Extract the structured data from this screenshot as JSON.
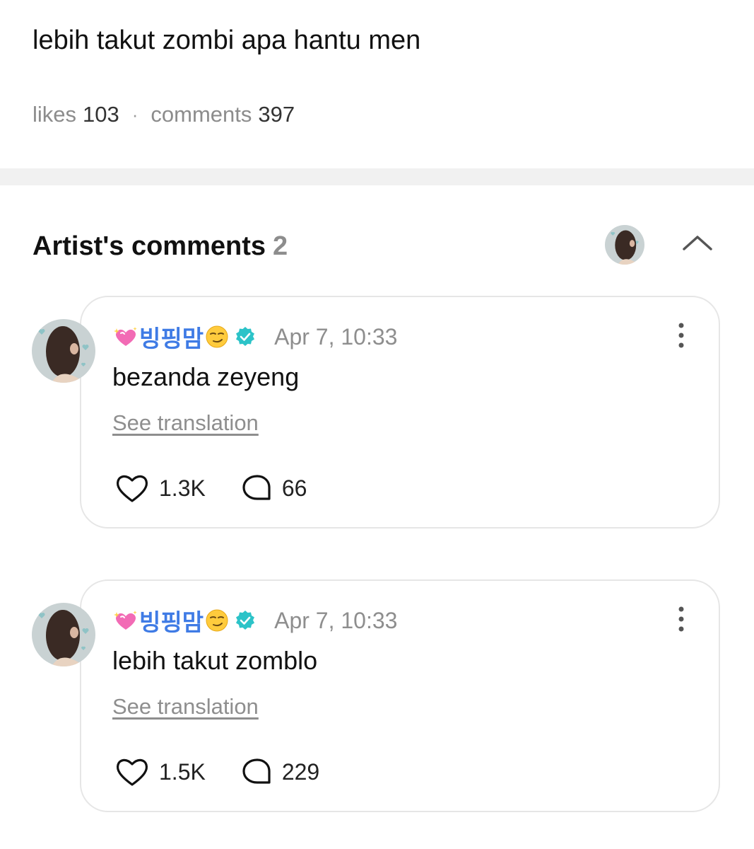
{
  "post": {
    "text": "lebih takut zombi apa hantu men",
    "likes_label": "likes",
    "likes_count": "103",
    "separator": "·",
    "comments_label": "comments",
    "comments_count": "397"
  },
  "artist_comments": {
    "title": "Artist's comments",
    "count": "2",
    "collapse_icon": "chevron-up-icon"
  },
  "comments": [
    {
      "author": "빙핑맘",
      "author_prefix_emoji": "sparkling-heart",
      "author_suffix_emoji": "smirking-face",
      "verified": true,
      "timestamp": "Apr 7, 10:33",
      "body": "bezanda zeyeng",
      "see_translation": "See translation",
      "likes": "1.3K",
      "replies": "66"
    },
    {
      "author": "빙핑맘",
      "author_prefix_emoji": "sparkling-heart",
      "author_suffix_emoji": "smirking-face",
      "verified": true,
      "timestamp": "Apr 7, 10:33",
      "body": "lebih takut zomblo",
      "see_translation": "See translation",
      "likes": "1.5K",
      "replies": "229"
    }
  ],
  "colors": {
    "author": "#3f7be5",
    "verified": "#2cc3c8",
    "muted": "#8e8e8e",
    "divider": "#f1f1f1"
  }
}
